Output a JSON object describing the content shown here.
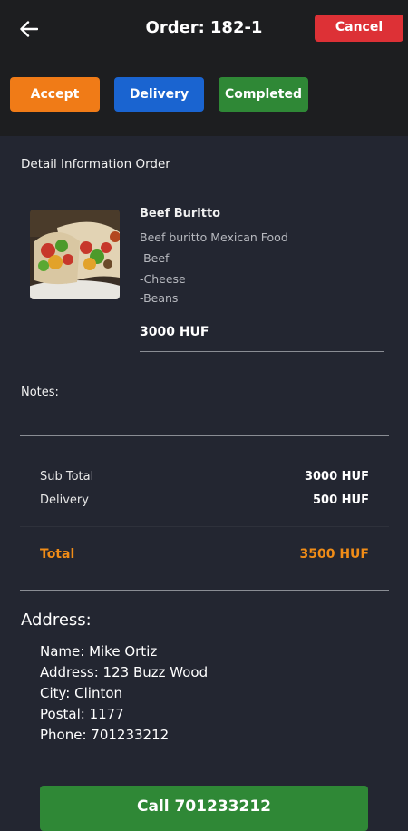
{
  "header": {
    "title_prefix": "Order:",
    "order_number": "182-1",
    "cancel_label": "Cancel"
  },
  "status_buttons": {
    "accept": "Accept",
    "delivery": "Delivery",
    "completed": "Completed"
  },
  "detail": {
    "section_title": "Detail Information Order",
    "item": {
      "name": "Beef Buritto",
      "description": "Beef buritto Mexican Food",
      "ingredients": [
        "-Beef",
        "-Cheese",
        "-Beans"
      ],
      "price": "3000 HUF"
    }
  },
  "notes": {
    "label": "Notes:"
  },
  "summary": {
    "subtotal_label": "Sub Total",
    "subtotal_value": "3000 HUF",
    "delivery_label": "Delivery",
    "delivery_value": "500 HUF",
    "total_label": "Total",
    "total_value": "3500 HUF"
  },
  "address": {
    "title": "Address:",
    "name": "Name: Mike Ortiz",
    "street": "Address: 123 Buzz Wood",
    "city": "City: Clinton",
    "postal": "Postal: 1177",
    "phone": "Phone: 701233212"
  },
  "call_button": {
    "label": "Call 701233212"
  },
  "colors": {
    "background": "#232631",
    "topbar": "#1d1e20",
    "accept": "#f07b17",
    "delivery": "#1a64d0",
    "completed": "#2f8836",
    "cancel": "#dd3136",
    "total_accent": "#f08c17"
  }
}
